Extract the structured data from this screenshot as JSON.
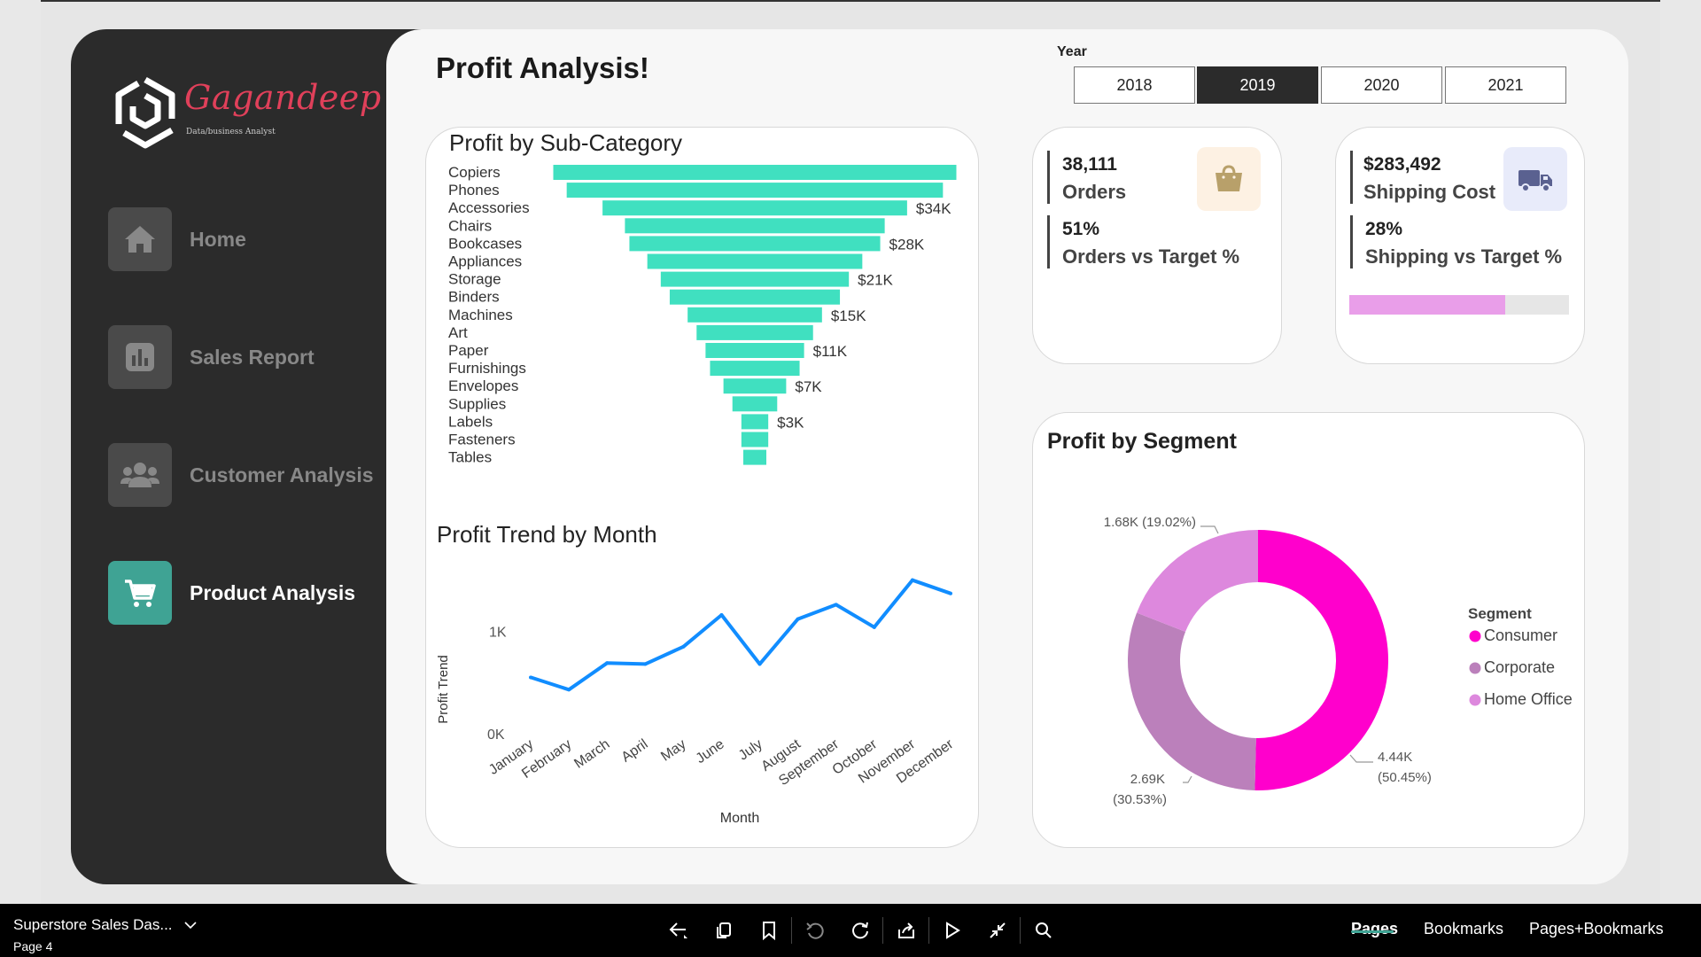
{
  "brand": {
    "name": "Gagandeep",
    "tagline": "Data/business Analyst"
  },
  "sidebar": {
    "items": [
      {
        "label": "Home",
        "icon": "home-icon"
      },
      {
        "label": "Sales Report",
        "icon": "bar-chart-icon"
      },
      {
        "label": "Customer Analysis",
        "icon": "users-icon"
      },
      {
        "label": "Product Analysis",
        "icon": "cart-icon",
        "active": true
      }
    ]
  },
  "page": {
    "title": "Profit Analysis!"
  },
  "year_filter": {
    "label": "Year",
    "options": [
      "2018",
      "2019",
      "2020",
      "2021"
    ],
    "selected": "2019"
  },
  "kpis": {
    "orders": {
      "value": "38,111",
      "label": "Orders",
      "pct": "51%",
      "pct_label": "Orders vs Target %",
      "icon": "shopping-bag-icon"
    },
    "shipping": {
      "value": "$283,492",
      "label": "Shipping Cost",
      "pct": "28%",
      "pct_label": "Shipping vs Target %",
      "icon": "truck-icon",
      "progress": 0.71
    }
  },
  "colors": {
    "accent": "#3fa394",
    "funnel": "#40e0c0",
    "line": "#118dff",
    "consumer": "#ff00cc",
    "corporate": "#bb80bb",
    "home_office": "#dd88dd",
    "progress": "#e99ee9"
  },
  "chart_data": [
    {
      "type": "bar",
      "title": "Profit by Sub-Category",
      "categories": [
        "Copiers",
        "Phones",
        "Accessories",
        "Chairs",
        "Bookcases",
        "Appliances",
        "Storage",
        "Binders",
        "Machines",
        "Art",
        "Paper",
        "Furnishings",
        "Envelopes",
        "Supplies",
        "Labels",
        "Fasteners",
        "Tables"
      ],
      "values": [
        45,
        42,
        34,
        29,
        28,
        24,
        21,
        19,
        15,
        13,
        11,
        10,
        7,
        5,
        3,
        3,
        0
      ],
      "data_labels": [
        "",
        "",
        "$34K",
        "",
        "$28K",
        "",
        "$21K",
        "",
        "$15K",
        "",
        "$11K",
        "",
        "$7K",
        "",
        "$3K",
        "",
        ""
      ]
    },
    {
      "type": "line",
      "title": "Profit Trend by Month",
      "xlabel": "Month",
      "ylabel": "Profit Trend",
      "categories": [
        "January",
        "February",
        "March",
        "April",
        "May",
        "June",
        "July",
        "August",
        "September",
        "October",
        "November",
        "December"
      ],
      "values": [
        550,
        430,
        690,
        680,
        850,
        1160,
        680,
        1120,
        1260,
        1040,
        1500,
        1370
      ],
      "ylim": [
        0,
        1800
      ],
      "yticks": [
        "0K",
        "1K"
      ]
    },
    {
      "type": "pie",
      "title": "Profit by Segment",
      "legend_title": "Segment",
      "labels": [
        "Consumer",
        "Corporate",
        "Home Office"
      ],
      "values": [
        4.44,
        2.69,
        1.68
      ],
      "data_labels": [
        [
          "4.44K",
          "(50.45%)"
        ],
        [
          "2.69K",
          "(30.53%)"
        ],
        [
          "1.68K (19.02%)"
        ]
      ]
    }
  ],
  "bottom_bar": {
    "report_name": "Superstore Sales Das...",
    "page": "Page 4",
    "tabs": [
      "Pages",
      "Bookmarks",
      "Pages+Bookmarks"
    ]
  }
}
